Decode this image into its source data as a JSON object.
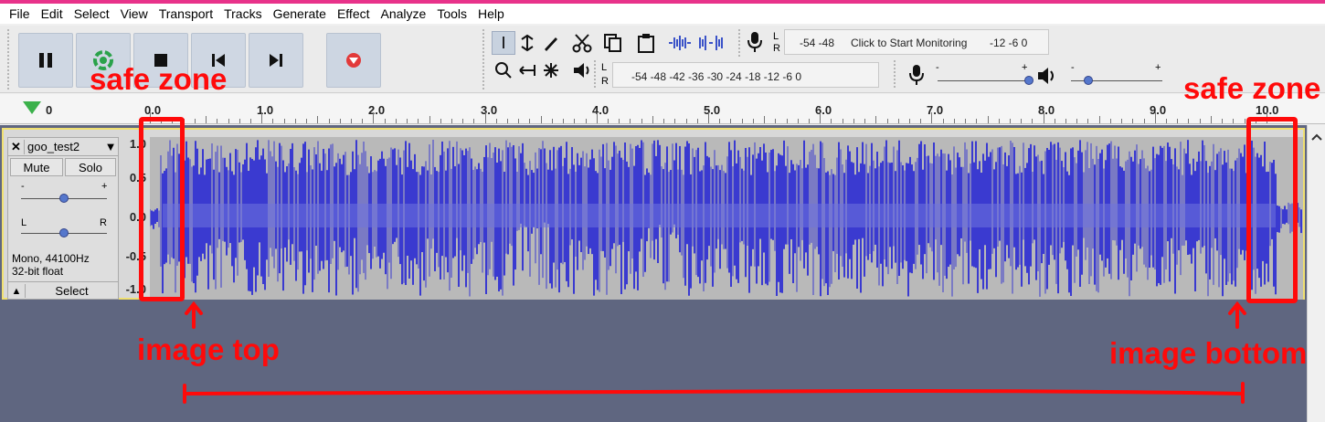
{
  "menu": [
    "File",
    "Edit",
    "Select",
    "View",
    "Transport",
    "Tracks",
    "Generate",
    "Effect",
    "Analyze",
    "Tools",
    "Help"
  ],
  "transport": {
    "buttons": [
      {
        "name": "pause",
        "icon": "pause-icon"
      },
      {
        "name": "play",
        "icon": "play-icon"
      },
      {
        "name": "stop",
        "icon": "stop-icon"
      },
      {
        "name": "skip-start",
        "icon": "skip-to-start-icon"
      },
      {
        "name": "skip-end",
        "icon": "skip-to-end-icon"
      },
      {
        "name": "record",
        "icon": "record-icon"
      }
    ]
  },
  "record_meter": {
    "lr_top": "L",
    "lr_bottom": "R",
    "scale_left": "-54  -48",
    "click_text": "Click to Start Monitoring",
    "scale_right": "-12  -6  0"
  },
  "playback_meter": {
    "lr_top": "L",
    "lr_bottom": "R",
    "scale": "-54  -48  -42  -36  -30  -24  -18  -12  -6  0"
  },
  "mixer": {
    "rec_minus": "-",
    "rec_plus": "+",
    "play_minus": "-",
    "play_plus": "+"
  },
  "ruler": {
    "labels": [
      "0",
      "0.0",
      "1.0",
      "2.0",
      "3.0",
      "4.0",
      "5.0",
      "6.0",
      "7.0",
      "8.0",
      "9.0",
      "10.0"
    ]
  },
  "track": {
    "name": "goo_test2",
    "close": "✕",
    "menu": "▼",
    "mute": "Mute",
    "solo": "Solo",
    "gain_minus": "-",
    "gain_plus": "+",
    "pan_left": "L",
    "pan_right": "R",
    "info_line1": "Mono, 44100Hz",
    "info_line2": "32-bit float",
    "collapse": "▲",
    "select": "Select",
    "amp_labels": [
      "1.0",
      "0.5",
      "0.0",
      "-0.5",
      "-1.0"
    ]
  },
  "annotations": {
    "safe_zone_left": "safe zone",
    "safe_zone_right": "safe zone",
    "image_top": "image top",
    "image_bottom": "image bottom"
  },
  "colors": {
    "wave_dark": "#3a3ad0",
    "wave_light": "#6f74dc",
    "wave_bg": "#b9b9b9",
    "annotation": "#ff0a0a",
    "window_border": "#e8328a"
  }
}
